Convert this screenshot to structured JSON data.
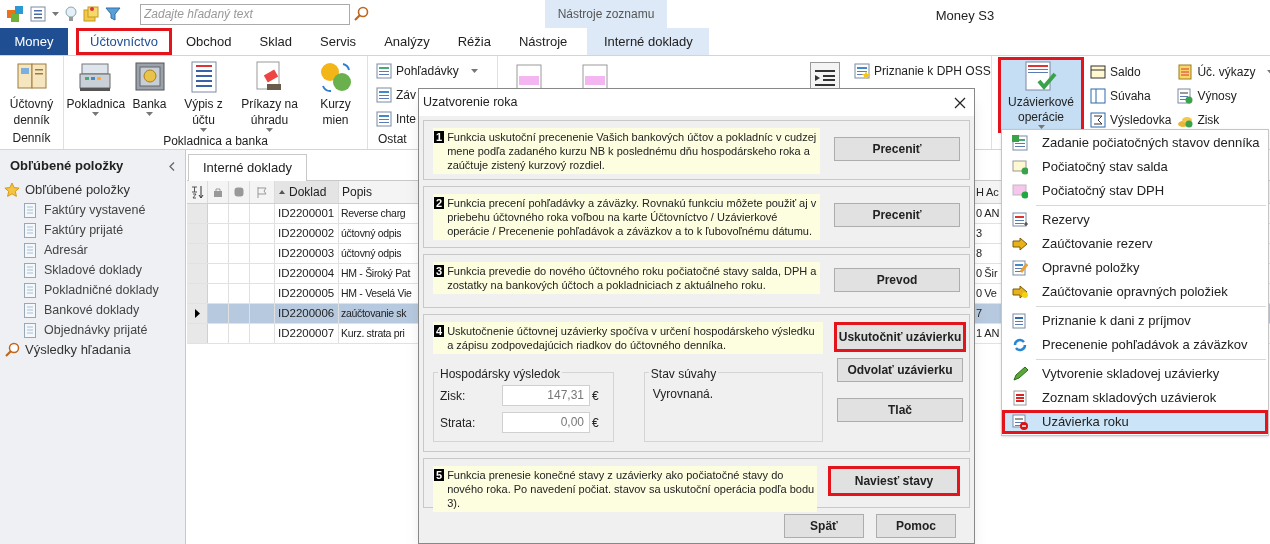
{
  "window": {
    "title": "Money S3"
  },
  "search": {
    "placeholder": "Zadajte hľadaný text"
  },
  "context_header": "Nástroje zoznamu",
  "tabs": [
    {
      "label": "Money",
      "kind": "file",
      "selected": false,
      "highlighted": false
    },
    {
      "label": "Účtovníctvo",
      "kind": "tab",
      "selected": true,
      "highlighted": true
    },
    {
      "label": "Obchod",
      "kind": "tab",
      "selected": false,
      "highlighted": false
    },
    {
      "label": "Sklad",
      "kind": "tab",
      "selected": false,
      "highlighted": false
    },
    {
      "label": "Servis",
      "kind": "tab",
      "selected": false,
      "highlighted": false
    },
    {
      "label": "Analýzy",
      "kind": "tab",
      "selected": false,
      "highlighted": false
    },
    {
      "label": "Réžia",
      "kind": "tab",
      "selected": false,
      "highlighted": false
    },
    {
      "label": "Nástroje",
      "kind": "tab",
      "selected": false,
      "highlighted": false
    },
    {
      "label": "Interné doklady",
      "kind": "context",
      "selected": false,
      "highlighted": false
    }
  ],
  "ribbon": {
    "groups": [
      {
        "label": "Denník",
        "buttons": [
          {
            "label": "Účtovný denník",
            "dropdown": false
          }
        ]
      },
      {
        "label": "Pokladnica a banka",
        "buttons": [
          {
            "label": "Pokladnica",
            "dropdown": true
          },
          {
            "label": "Banka",
            "dropdown": true
          },
          {
            "label": "Výpis z účtu",
            "dropdown": true
          },
          {
            "label": "Príkazy na úhradu",
            "dropdown": true
          },
          {
            "label": "Kurzy mien",
            "dropdown": false
          }
        ]
      },
      {
        "label": "Ostat",
        "small_buttons": [
          {
            "label": "Pohľadávky",
            "dropdown": true
          },
          {
            "label": "Záv"
          },
          {
            "label": "Inte"
          }
        ]
      }
    ],
    "oss_button": "Priznanie k DPH OSS",
    "closing_button": {
      "label": "Uzávierkové operácie",
      "dropdown": true,
      "selected": true,
      "highlighted": true
    },
    "report_buttons": [
      {
        "label": "Saldo",
        "dropdown": false
      },
      {
        "label": "Súvaha",
        "dropdown": false
      },
      {
        "label": "Výsledovka",
        "dropdown": false
      },
      {
        "label": "Úč. výkazy",
        "dropdown": true
      },
      {
        "label": "Výnosy",
        "dropdown": false
      },
      {
        "label": "Zisk",
        "dropdown": false
      }
    ]
  },
  "sidebar": {
    "title": "Obľúbené položky",
    "items": [
      {
        "label": "Obľúbené položky",
        "children": [
          {
            "label": "Faktúry vystavené"
          },
          {
            "label": "Faktúry prijaté"
          },
          {
            "label": "Adresár"
          },
          {
            "label": "Skladové doklady"
          },
          {
            "label": "Pokladničné doklady"
          },
          {
            "label": "Bankové doklady"
          },
          {
            "label": "Objednávky prijaté"
          }
        ]
      },
      {
        "label": "Výsledky hľadania"
      }
    ]
  },
  "table": {
    "tab": "Interné doklady",
    "columns": [
      "Doklad",
      "Popis"
    ],
    "tail_columns": [
      "H",
      "Ac"
    ],
    "rows": [
      {
        "doklad": "ID2200001",
        "popis": "Reverse charg",
        "tail": [
          "0",
          "AN"
        ],
        "selected": false
      },
      {
        "doklad": "ID2200002",
        "popis": "účtovný odpis",
        "tail": [
          "3"
        ],
        "selected": false
      },
      {
        "doklad": "ID2200003",
        "popis": "účtovný odpis",
        "tail": [
          "8"
        ],
        "selected": false
      },
      {
        "doklad": "ID2200004",
        "popis": "HM - Široký Pat",
        "tail": [
          "0",
          "Šir"
        ],
        "selected": false
      },
      {
        "doklad": "ID2200005",
        "popis": "HM - Veselá Vie",
        "tail": [
          "0",
          "Ve"
        ],
        "selected": false
      },
      {
        "doklad": "ID2200006",
        "popis": "zaúčtovanie sk",
        "tail": [
          "7"
        ],
        "selected": true
      },
      {
        "doklad": "ID2200007",
        "popis": "Kurz. strata pri",
        "tail": [
          "1",
          "AN"
        ],
        "selected": false
      }
    ]
  },
  "dialog": {
    "title": "Uzatvorenie roka",
    "steps": [
      {
        "number": "1",
        "text": "Funkcia uskutoční precenenie Vašich bankových účtov a pokladníc v cudzej mene podľa zadaného kurzu NB k poslednému dňu hospodárskeho roka a zaúčtuje zistený kurzový rozdiel.",
        "buttons": [
          {
            "label": "Preceniť",
            "highlighted": false
          }
        ]
      },
      {
        "number": "2",
        "text": "Funkcia precení pohľadávky a záväzky. Rovnakú funkciu môžete použiť aj v priebehu účtovného roka voľbou na karte Účtovníctvo / Uzávierkové operácie / Precenenie pohľadávok a záväzkov a to k ľubovoľnému dátumu.",
        "buttons": [
          {
            "label": "Preceniť",
            "highlighted": false
          }
        ]
      },
      {
        "number": "3",
        "text": "Funkcia prevedie do nového účtovného roku počiatočné stavy salda, DPH a zostatky na bankových účtoch a pokladniciach z aktuálneho roku.",
        "buttons": [
          {
            "label": "Prevod",
            "highlighted": false
          }
        ]
      },
      {
        "number": "4",
        "text": "Uskutočnenie účtovnej uzávierky spočíva v určení hospodárskeho výsledku a zápisu zodpovedajúcich riadkov do účtovného denníka.",
        "buttons": [
          {
            "label": "Uskutočniť uzávierku",
            "highlighted": true
          },
          {
            "label": "Odvolať uzávierku",
            "highlighted": false
          },
          {
            "label": "Tlač",
            "highlighted": false
          }
        ],
        "result": {
          "title": "Hospodársky výsledok",
          "fields": [
            {
              "label": "Zisk:",
              "value": "147,31",
              "unit": "€"
            },
            {
              "label": "Strata:",
              "value": "0,00",
              "unit": "€"
            }
          ]
        },
        "balance": {
          "title": "Stav súvahy",
          "text": "Vyrovnaná."
        }
      },
      {
        "number": "5",
        "text": "Funkcia prenesie konečné stavy z uzávierky ako počiatočné stavy do nového roka. Po navedení počiat. stavov sa uskutoční operácia podľa bodu 3).",
        "buttons": [
          {
            "label": "Naviesť stavy",
            "highlighted": true
          }
        ]
      }
    ],
    "footer_buttons": [
      "Späť",
      "Pomoc"
    ]
  },
  "menu": {
    "groups": [
      [
        {
          "label": "Zadanie počiatočných stavov denníka",
          "selected": false,
          "highlighted": false
        },
        {
          "label": "Počiatočný stav salda",
          "selected": false,
          "highlighted": false
        },
        {
          "label": "Počiatočný stav DPH",
          "selected": false,
          "highlighted": false
        }
      ],
      [
        {
          "label": "Rezervy",
          "selected": false,
          "highlighted": false
        },
        {
          "label": "Zaúčtovanie rezerv",
          "selected": false,
          "highlighted": false
        },
        {
          "label": "Opravné položky",
          "selected": false,
          "highlighted": false
        },
        {
          "label": "Zaúčtovanie opravných položiek",
          "selected": false,
          "highlighted": false
        }
      ],
      [
        {
          "label": "Priznanie k dani z príjmov",
          "selected": false,
          "highlighted": false
        },
        {
          "label": "Precenenie pohľadávok a záväzkov",
          "selected": false,
          "highlighted": false
        }
      ],
      [
        {
          "label": "Vytvorenie skladovej uzávierky",
          "selected": false,
          "highlighted": false
        },
        {
          "label": "Zoznam skladových uzávierok",
          "selected": false,
          "highlighted": false
        },
        {
          "label": "Uzávierka roku",
          "selected": true,
          "highlighted": true
        }
      ]
    ]
  }
}
